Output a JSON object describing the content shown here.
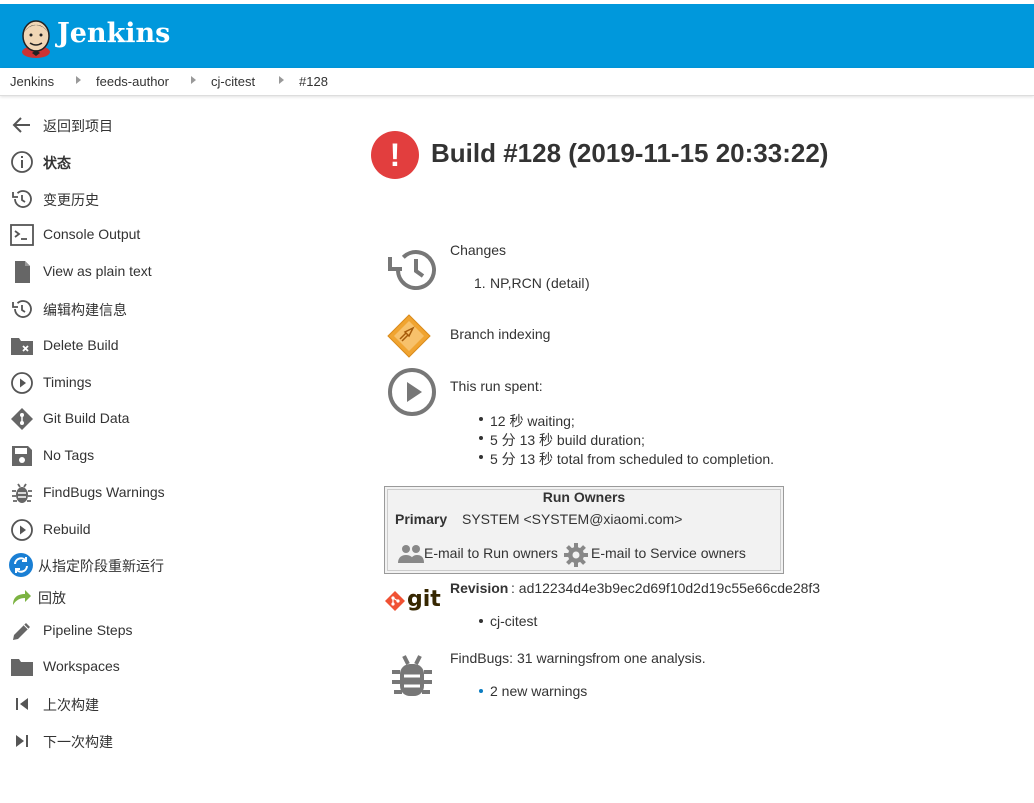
{
  "header": {
    "brand": "Jenkins",
    "logo": "jenkins-butler-logo"
  },
  "breadcrumb": [
    "Jenkins",
    "feeds-author",
    "cj-citest",
    "#128"
  ],
  "sidebar": {
    "items": [
      {
        "label": "返回到项目",
        "icon": "arrow-left-icon"
      },
      {
        "label": "状态",
        "icon": "info-icon"
      },
      {
        "label": "变更历史",
        "icon": "history-icon"
      },
      {
        "label": "Console Output",
        "icon": "terminal-icon"
      },
      {
        "label": "View as plain text",
        "icon": "document-icon"
      },
      {
        "label": "编辑构建信息",
        "icon": "history-icon"
      },
      {
        "label": "Delete Build",
        "icon": "folder-delete-icon"
      },
      {
        "label": "Timings",
        "icon": "play-circle-icon"
      },
      {
        "label": "Git Build Data",
        "icon": "git-icon"
      },
      {
        "label": "No Tags",
        "icon": "save-icon"
      },
      {
        "label": "FindBugs Warnings",
        "icon": "bug-icon"
      },
      {
        "label": "Rebuild",
        "icon": "play-circle-icon"
      },
      {
        "label": "从指定阶段重新运行",
        "icon": "refresh-icon"
      },
      {
        "label": "回放",
        "icon": "replay-arrow-icon"
      },
      {
        "label": "Pipeline Steps",
        "icon": "pencil-icon"
      },
      {
        "label": "Workspaces",
        "icon": "folder-icon"
      },
      {
        "label": "上次构建",
        "icon": "previous-icon"
      },
      {
        "label": "下一次构建",
        "icon": "next-icon"
      }
    ]
  },
  "build": {
    "status_icon": "!",
    "status_color": "#e23e3e",
    "title": "Build #128 (2019-11-15 20:33:22)"
  },
  "changes": {
    "heading": "Changes",
    "item_number": "1.",
    "item_text": "NP,RCN (",
    "detail_link": "detail",
    "close_paren": ")"
  },
  "branch_indexing": "Branch indexing",
  "run_spent": {
    "heading": "This run spent:",
    "items": [
      "12 秒 waiting;",
      "5 分 13 秒 build duration;",
      "5 分 13 秒 total from scheduled to completion."
    ]
  },
  "run_owners": {
    "title": "Run Owners",
    "primary_label": "Primary",
    "primary_value": "SYSTEM <SYSTEM@xiaomi.com>",
    "email_run_owners": "E-mail to Run owners",
    "email_service_owners": "E-mail to Service owners"
  },
  "git": {
    "logo_text": "git",
    "revision_label": "Revision",
    "revision_value": ": ad12234d4e3b9ec2d69f10d2d19c55e66cde28f3",
    "branch": "cj-citest"
  },
  "findbugs": {
    "prefix": "FindBugs: ",
    "warnings_link": "31 warnings",
    "suffix": " from one analysis.",
    "new_warnings_link": "2 new warnings"
  },
  "colors": {
    "header": "#0098dc",
    "link": "#0b7cc1",
    "error": "#e23e3e"
  }
}
